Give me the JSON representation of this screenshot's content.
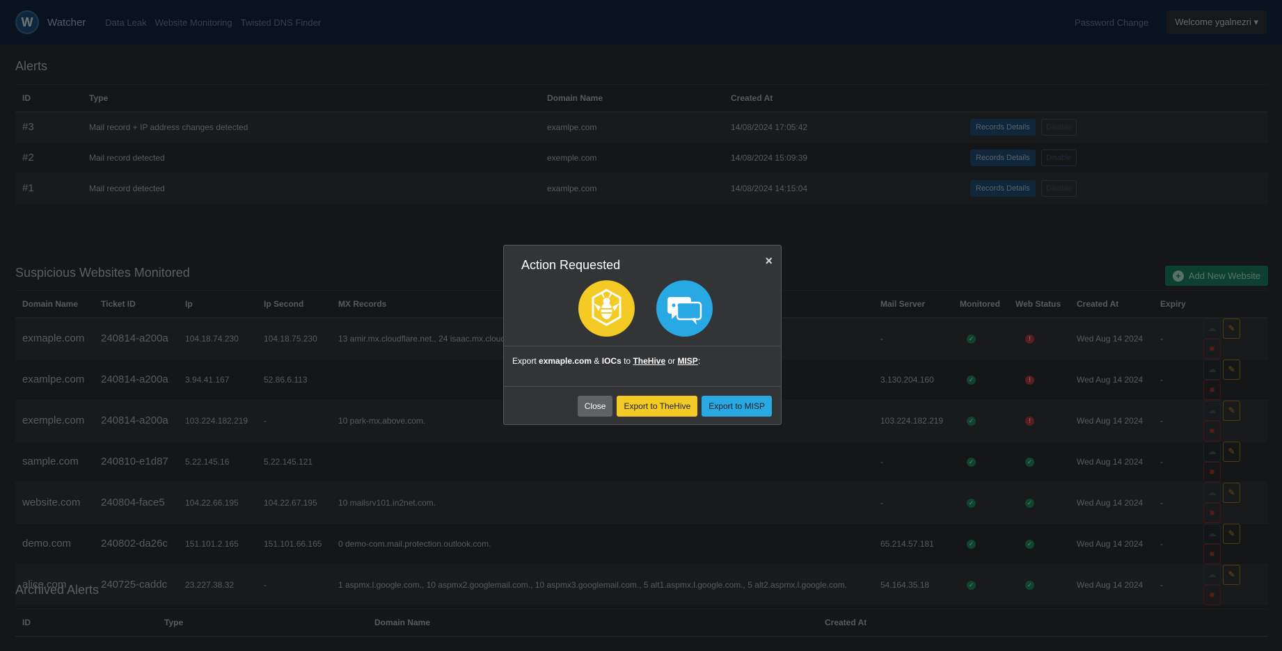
{
  "navbar": {
    "brand_letter": "W",
    "brand": "Watcher",
    "links": [
      "Data Leak",
      "Website Monitoring",
      "Twisted DNS Finder"
    ],
    "password_change": "Password Change",
    "welcome": "Welcome ygalnezri"
  },
  "alerts": {
    "title": "Alerts",
    "headers": [
      "ID",
      "Type",
      "Domain Name",
      "Created At"
    ],
    "rows": [
      {
        "id": "#3",
        "type": "Mail record + IP address changes detected",
        "domain": "examlpe.com",
        "created": "14/08/2024 17:05:42"
      },
      {
        "id": "#2",
        "type": "Mail record detected",
        "domain": "exemple.com",
        "created": "14/08/2024 15:09:39"
      },
      {
        "id": "#1",
        "type": "Mail record detected",
        "domain": "examlpe.com",
        "created": "14/08/2024 14:15:04"
      }
    ],
    "records_btn": "Records Details",
    "disable_btn": "Disable"
  },
  "websites": {
    "title": "Suspicious Websites Monitored",
    "add_btn": "Add New Website",
    "headers": [
      "Domain Name",
      "Ticket ID",
      "Ip",
      "Ip Second",
      "MX Records",
      "Mail Server",
      "Monitored",
      "Web Status",
      "Created At",
      "Expiry"
    ],
    "rows": [
      {
        "domain": "exmaple.com",
        "ticket": "240814-a200a",
        "ip": "104.18.74.230",
        "ip2": "104.18.75.230",
        "mx": "13 amir.mx.cloudflare.net., 24 isaac.mx.cloudflare.net., 86 linda.mx.cloudflare.net.",
        "mail": "-",
        "web_ok": false,
        "created": "Wed Aug 14 2024",
        "expiry": "-"
      },
      {
        "domain": "examlpe.com",
        "ticket": "240814-a200a",
        "ip": "3.94.41.167",
        "ip2": "52.86.6.113",
        "mx": "",
        "mail": "3.130.204.160",
        "web_ok": false,
        "created": "Wed Aug 14 2024",
        "expiry": "-"
      },
      {
        "domain": "exemple.com",
        "ticket": "240814-a200a",
        "ip": "103.224.182.219",
        "ip2": "-",
        "mx": "10 park-mx.above.com.",
        "mail": "103.224.182.219",
        "web_ok": false,
        "created": "Wed Aug 14 2024",
        "expiry": "-"
      },
      {
        "domain": "sample.com",
        "ticket": "240810-e1d87",
        "ip": "5.22.145.16",
        "ip2": "5.22.145.121",
        "mx": "",
        "mail": "-",
        "web_ok": true,
        "created": "Wed Aug 14 2024",
        "expiry": "-"
      },
      {
        "domain": "website.com",
        "ticket": "240804-face5",
        "ip": "104.22.66.195",
        "ip2": "104.22.67.195",
        "mx": "10 mailsrv101.in2net.com.",
        "mail": "-",
        "web_ok": true,
        "created": "Wed Aug 14 2024",
        "expiry": "-"
      },
      {
        "domain": "demo.com",
        "ticket": "240802-da26c",
        "ip": "151.101.2.165",
        "ip2": "151.101.66.165",
        "mx": "0 demo-com.mail.protection.outlook.com.",
        "mail": "65.214.57.181",
        "web_ok": true,
        "created": "Wed Aug 14 2024",
        "expiry": "-"
      },
      {
        "domain": "alice.com",
        "ticket": "240725-caddc",
        "ip": "23.227.38.32",
        "ip2": "-",
        "mx": "1 aspmx.l.google.com., 10 aspmx2.googlemail.com., 10 aspmx3.googlemail.com., 5 alt1.aspmx.l.google.com., 5 alt2.aspmx.l.google.com.",
        "mail": "54.164.35.18",
        "web_ok": true,
        "created": "Wed Aug 14 2024",
        "expiry": "-"
      }
    ]
  },
  "archived": {
    "title": "Archived Alerts",
    "headers": [
      "ID",
      "Type",
      "Domain Name",
      "Created At"
    ]
  },
  "modal": {
    "title": "Action Requested",
    "close_x": "×",
    "body": {
      "prefix": "Export ",
      "domain": "exmaple.com",
      "amp": " & ",
      "iocs": "IOCs",
      "to": " to ",
      "thehive": "TheHive",
      "or": " or ",
      "misp": "MISP",
      "suffix": ":"
    },
    "close_btn": "Close",
    "thehive_btn": "Export to TheHive",
    "misp_btn": "Export to MISP"
  },
  "colors": {
    "navbar": "#12263f",
    "thehive": "#f4ca25",
    "misp": "#29a9e3",
    "add_btn": "#1b8060"
  }
}
